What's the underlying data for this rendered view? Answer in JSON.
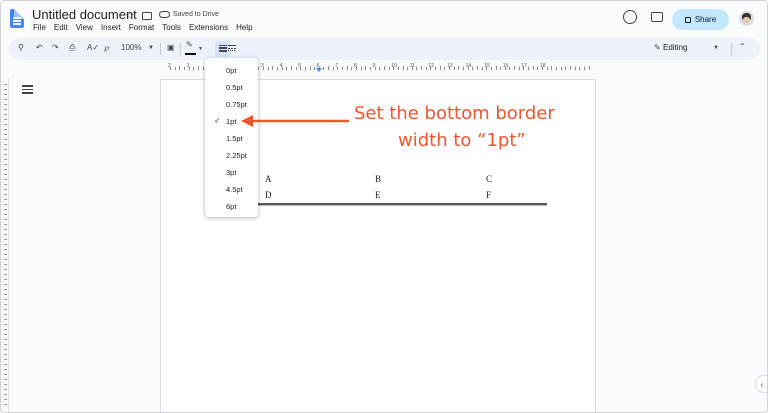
{
  "header": {
    "title": "Untitled document",
    "saved_status": "Saved to Drive",
    "menu": [
      "File",
      "Edit",
      "View",
      "Insert",
      "Format",
      "Tools",
      "Extensions",
      "Help"
    ],
    "share_label": "Share"
  },
  "toolbar": {
    "zoom": "100%",
    "mode": "Editing"
  },
  "ruler": {
    "numbers": [
      "2",
      "1",
      "1",
      "2",
      "3",
      "4",
      "5",
      "6",
      "7",
      "8",
      "9",
      "10",
      "11",
      "12",
      "13",
      "14",
      "15",
      "16",
      "17",
      "18"
    ]
  },
  "border_width_menu": {
    "options": [
      "0pt",
      "0.5pt",
      "0.75pt",
      "1pt",
      "1.5pt",
      "2.25pt",
      "3pt",
      "4.5pt",
      "6pt"
    ],
    "selected": "1pt"
  },
  "table": {
    "rows": [
      [
        "A",
        "B",
        "C"
      ],
      [
        "D",
        "E",
        "F"
      ]
    ]
  },
  "annotation": {
    "line1": "Set the bottom border",
    "line2": "width to “1pt”",
    "color": "#f0562b"
  },
  "colors": {
    "share_bg": "#c2e7ff",
    "toolbar_bg": "#edf2fa",
    "doc_blue": "#4285f4"
  }
}
